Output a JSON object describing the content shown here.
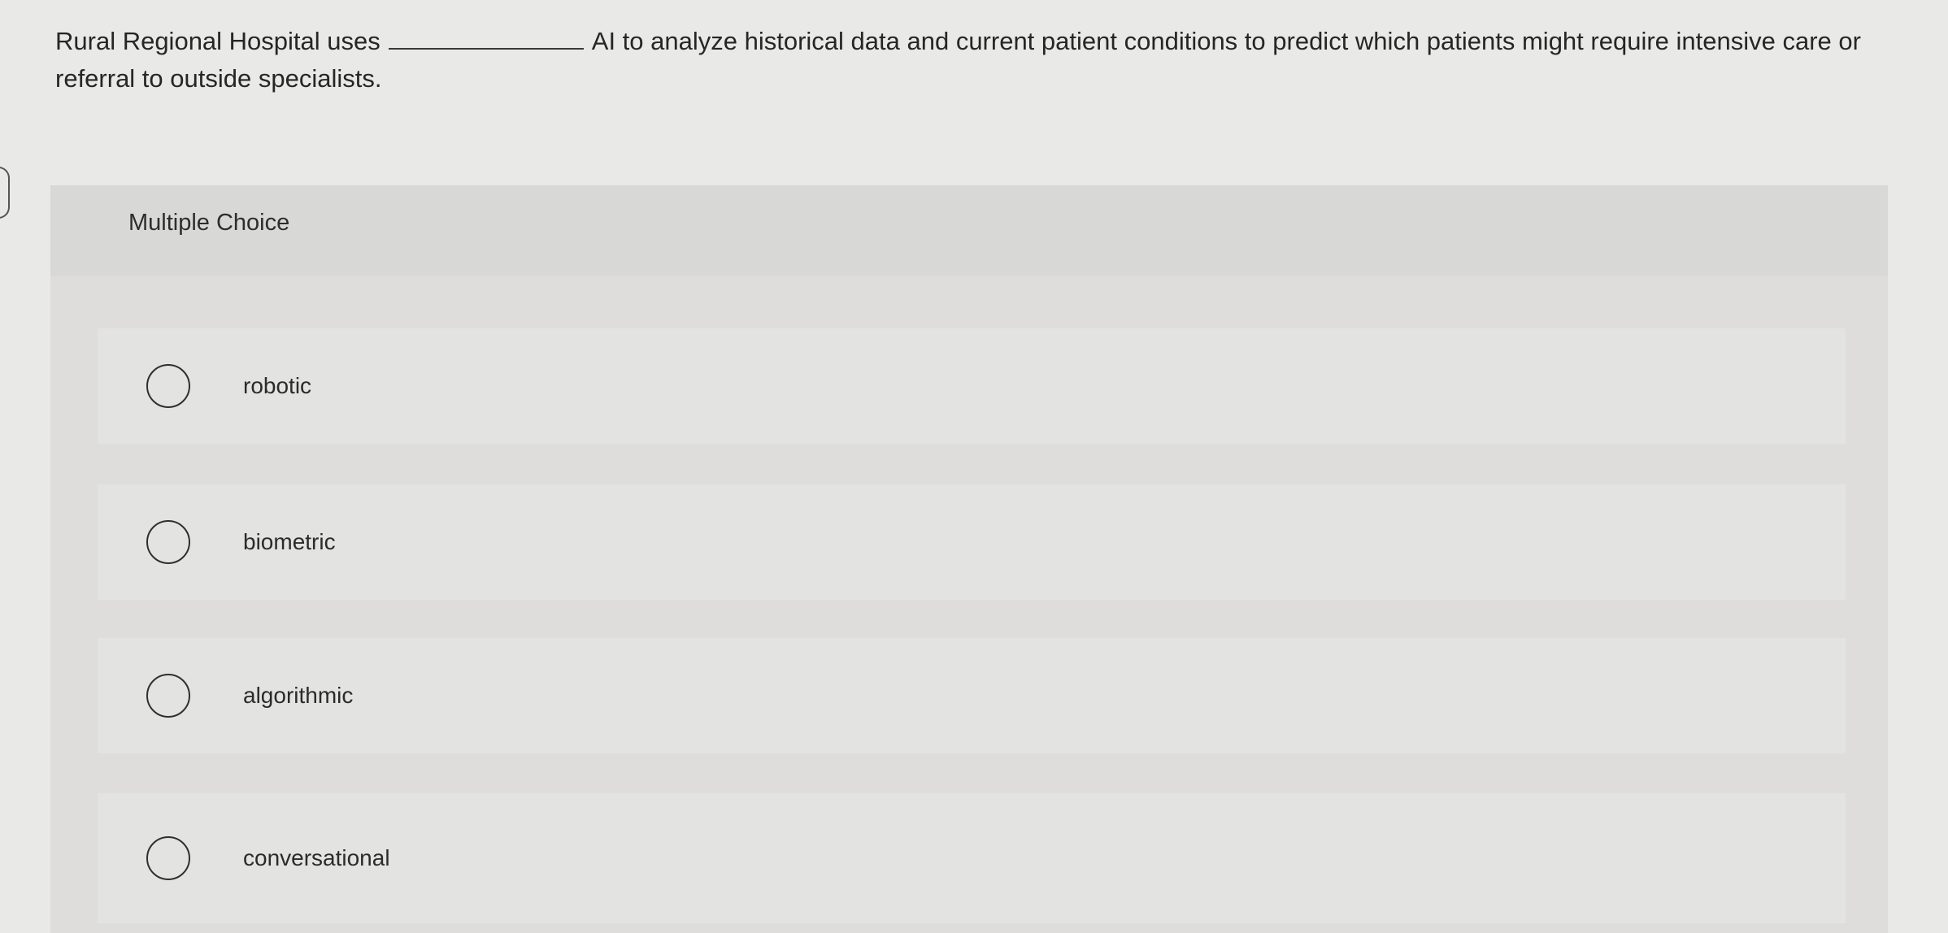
{
  "question": {
    "text_before": "Rural Regional Hospital uses",
    "text_after": "AI to analyze historical data and current patient conditions to predict which patients might require intensive care or referral to outside specialists."
  },
  "multiple_choice": {
    "header": "Multiple Choice",
    "options": [
      {
        "label": "robotic",
        "selected": false
      },
      {
        "label": "biometric",
        "selected": false
      },
      {
        "label": "algorithmic",
        "selected": false
      },
      {
        "label": "conversational",
        "selected": false
      }
    ]
  }
}
